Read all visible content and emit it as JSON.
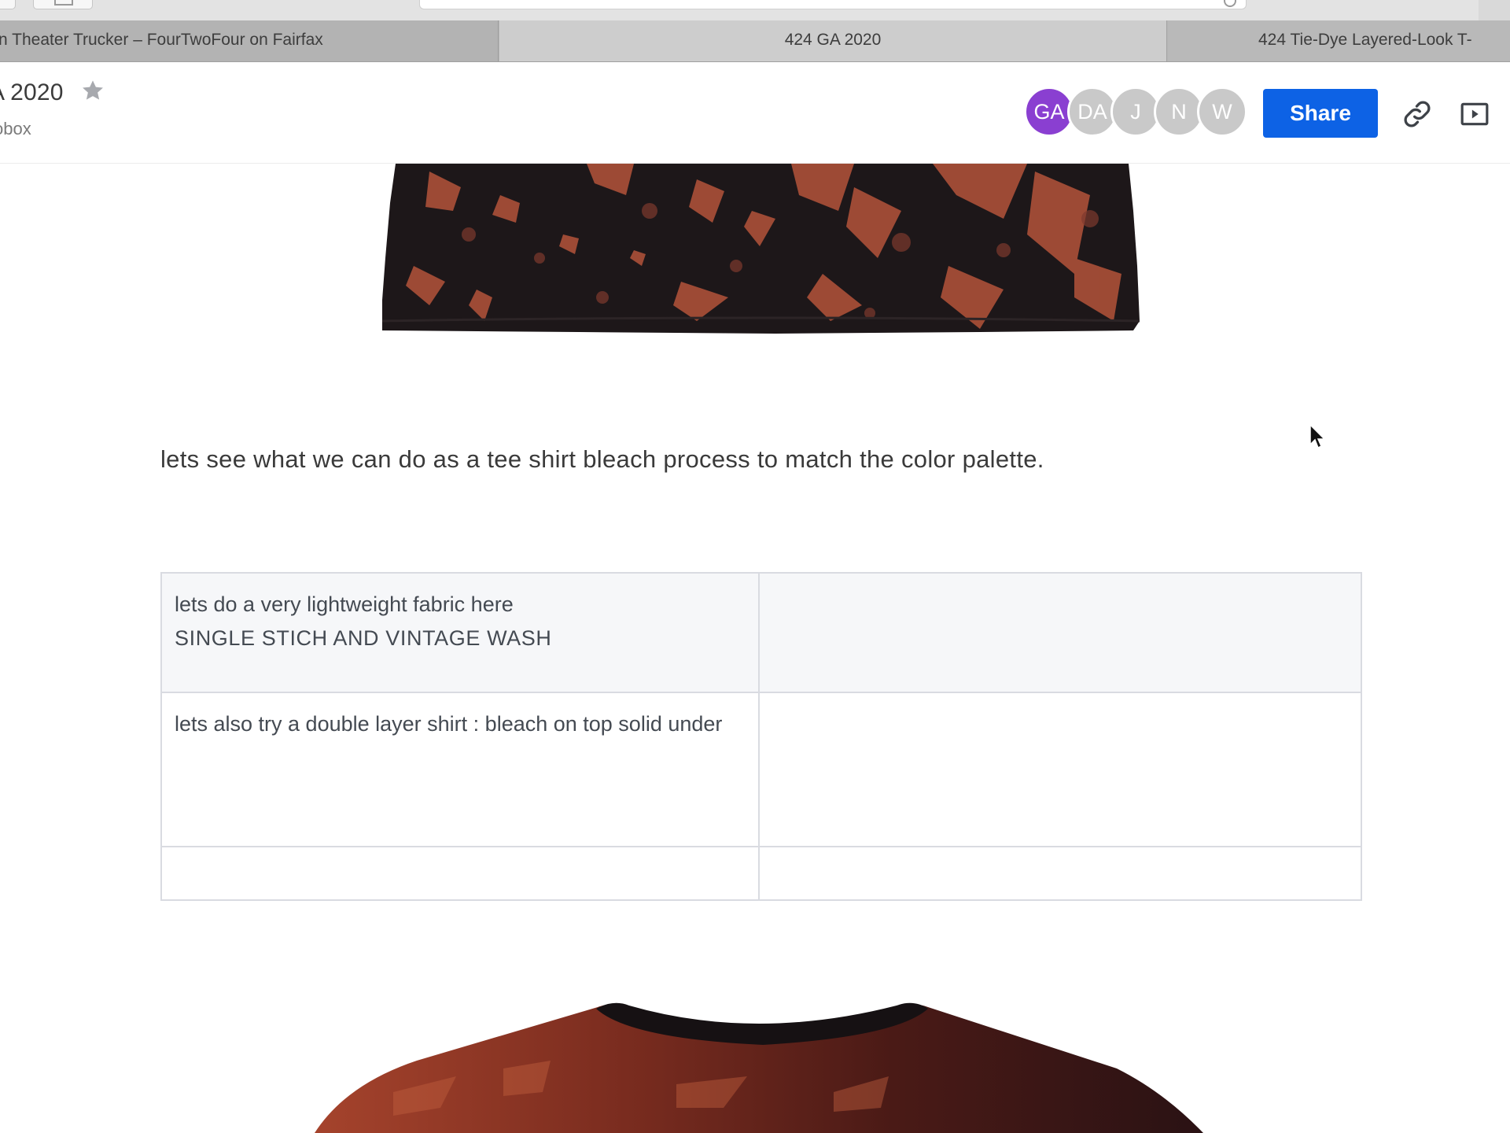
{
  "browser": {
    "tabs": [
      {
        "label": "n Theater Trucker – FourTwoFour on Fairfax"
      },
      {
        "label": "424 GA 2020"
      },
      {
        "label": "424 Tie-Dye Layered-Look T-"
      }
    ]
  },
  "header": {
    "title": "A 2020",
    "folder": "obox",
    "share_label": "Share",
    "star_icon": "star-icon",
    "link_icon": "link-icon",
    "present_icon": "present-icon",
    "avatars": [
      {
        "initials": "GA",
        "color": "#8a3fd1"
      },
      {
        "initials": "DA",
        "color": "#c9c9c9"
      },
      {
        "initials": "J",
        "color": "#c9c9c9"
      },
      {
        "initials": "N",
        "color": "#c9c9c9"
      },
      {
        "initials": "W",
        "color": "#c9c9c9"
      }
    ]
  },
  "content": {
    "paragraph": "lets see what we can do as a tee shirt bleach process to match the color palette.",
    "table": {
      "rows": [
        [
          "lets do a very lightweight fabric here",
          "SINGLE STICH AND VINTAGE WASH"
        ],
        [
          "lets also try a double layer shirt : bleach on top solid under"
        ],
        [
          ""
        ]
      ]
    },
    "images": [
      "bleached-shirt-hem-image",
      "bleached-shirt-collar-image"
    ]
  },
  "colors": {
    "share_button": "#0d62e5",
    "accent_avatar": "#8a3fd1",
    "shirt_dark": "#1c1618",
    "shirt_bleach": "#b4533a"
  }
}
